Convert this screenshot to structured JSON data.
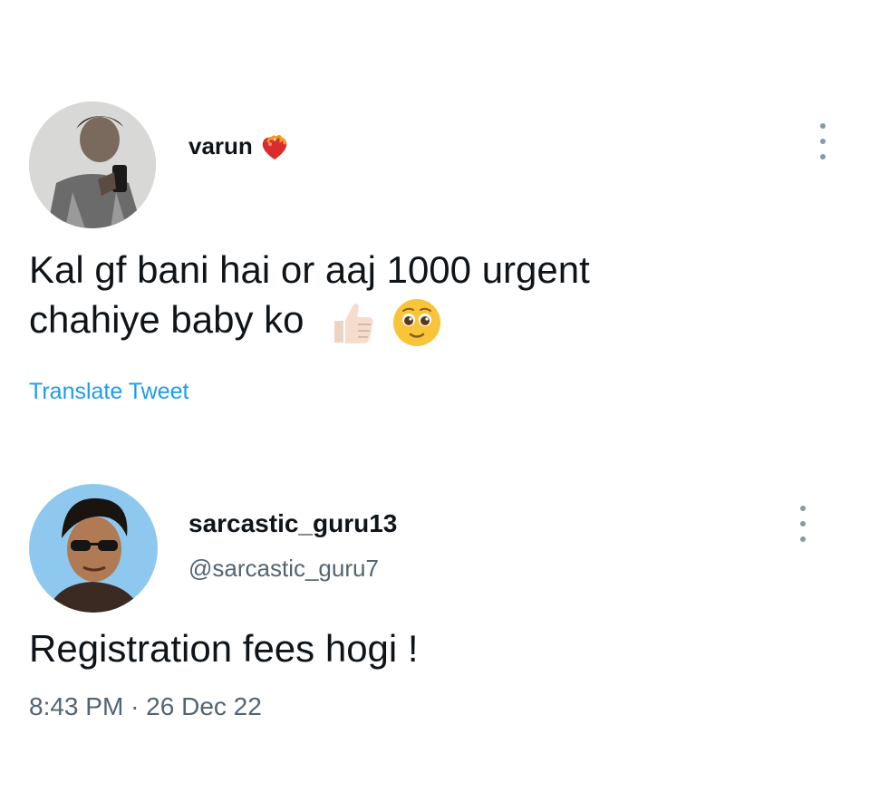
{
  "tweet": {
    "author_name": "varun",
    "name_emoji": "heart-on-fire-icon",
    "text_line1": "Kal gf bani hai or aaj 1000 urgent",
    "text_line2": "chahiye baby ko",
    "emojis": [
      "thumbs-up-icon",
      "pleading-face-icon"
    ],
    "translate_label": "Translate Tweet"
  },
  "reply": {
    "author_name": "sarcastic_guru13",
    "handle": "@sarcastic_guru7",
    "text": "Registration fees hogi !",
    "time": "8:43 PM",
    "separator": "·",
    "date": "26 Dec 22"
  },
  "colors": {
    "text": "#0f1419",
    "secondary": "#536471",
    "link": "#1d9bf0",
    "background": "#ffffff"
  }
}
